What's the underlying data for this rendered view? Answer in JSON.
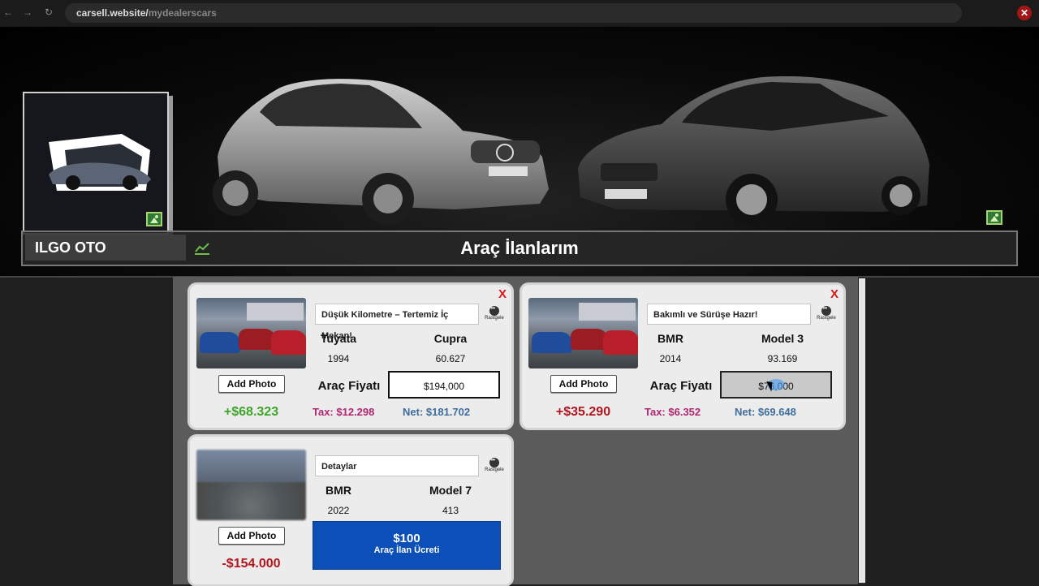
{
  "browser": {
    "url_host": "carsell.website/",
    "url_path": "mydealerscars",
    "close_label": "✕"
  },
  "banner": {
    "dealer_name": "ILGO OTO",
    "page_title": "Araç İlanlarım"
  },
  "cards": [
    {
      "description": "Düşük Kilometre – Tertemiz İç Mekan!",
      "random_label": "Rastgele",
      "brand": "Tuyata",
      "model": "Cupra",
      "year": "1994",
      "mileage": "60.627",
      "add_photo": "Add Photo",
      "price_label": "Araç Fiyatı",
      "price": "$194,000",
      "profit": "+$68.323",
      "profit_color": "#3fa52a",
      "tax": "Tax: $12.298",
      "net": "Net: $181.702",
      "close": "X"
    },
    {
      "description": "Bakımlı ve Sürüşe Hazır!",
      "random_label": "Rastgele",
      "brand": "BMR",
      "model": "Model 3",
      "year": "2014",
      "mileage": "93.169",
      "add_photo": "Add Photo",
      "price_label": "Araç Fiyatı",
      "price": "$76,000",
      "profit": "+$35.290",
      "profit_color": "#b3151e",
      "tax": "Tax: $6.352",
      "net": "Net: $69.648",
      "close": "X"
    },
    {
      "description": "Detaylar",
      "random_label": "Rastgele",
      "brand": "BMR",
      "model": "Model 7",
      "year": "2022",
      "mileage": "413",
      "add_photo": "Add Photo",
      "profit": "-$154.000",
      "profit_color": "#b3151e",
      "fee_amount": "$100",
      "fee_label": "Araç İlan Ücreti"
    }
  ]
}
